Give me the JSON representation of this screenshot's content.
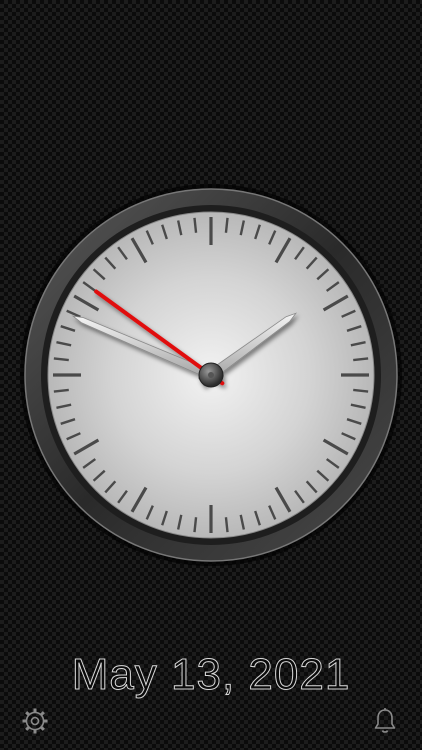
{
  "date": "May 13, 2021",
  "clock": {
    "hour": 1,
    "minute": 48,
    "second": 51
  },
  "colors": {
    "second_hand": "#e01010",
    "bezel": "#3a3a3a",
    "face": "#d9d9d9",
    "date_text": "#d8d8d8",
    "icon": "#8a8a8a"
  },
  "icons": {
    "settings": "gear-icon",
    "alarm": "bell-icon"
  }
}
